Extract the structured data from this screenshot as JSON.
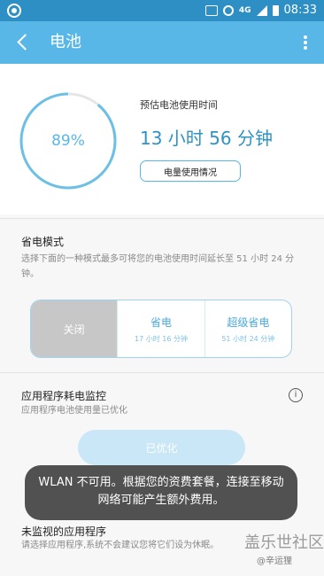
{
  "status_bar": {
    "network": "4G",
    "time": "08:33"
  },
  "app_bar": {
    "title": "电池"
  },
  "battery": {
    "percent": 89,
    "percent_label": "89%",
    "estimate_label": "预估电池使用时间",
    "estimate_time": "13 小时 56 分钟",
    "usage_button": "电量使用情况"
  },
  "power_saving": {
    "title": "省电模式",
    "description": "选择下面的一种模式最多可将您的电池使用时间延长至 51 小时 24 分钟。",
    "options": [
      {
        "name": "关闭",
        "selected": true
      },
      {
        "name": "省电",
        "sub": "17 小时 16 分钟"
      },
      {
        "name": "超级省电",
        "sub": "51 小时 24 分钟"
      }
    ]
  },
  "app_monitor": {
    "title": "应用程序耗电监控",
    "status": "应用程序电池使用量已优化",
    "button": "已优化"
  },
  "unmonitored": {
    "title": "未监视的应用程序",
    "description": "请选择应用程序,系统不会建议您将它们设为休眠。"
  },
  "toast": {
    "text": "WLAN 不可用。根据您的资费套餐，连接至移动网络可能产生额外费用。"
  },
  "watermark": {
    "title": "盖乐世社区",
    "sub": "@辛运狸"
  },
  "colors": {
    "status_bar": "#2d8fc4",
    "app_bar": "#58b7e6",
    "accent": "#2f93c4"
  }
}
